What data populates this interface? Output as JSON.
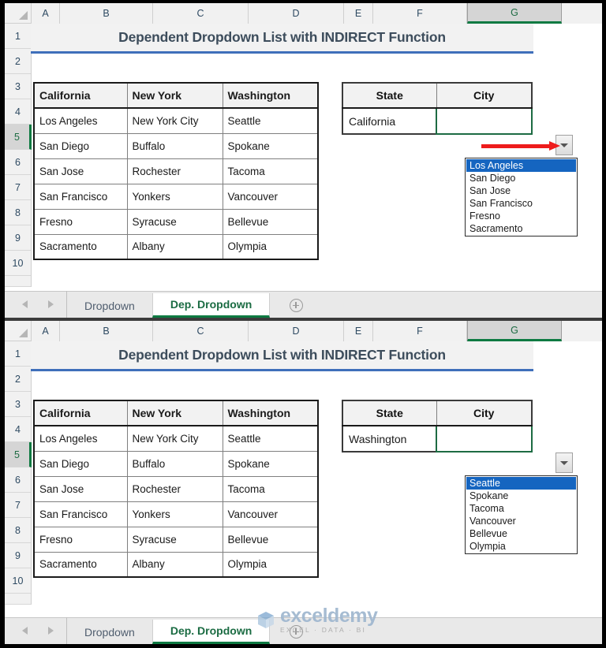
{
  "app": {
    "title": "Dependent Dropdown List with INDIRECT Function"
  },
  "columns": [
    "A",
    "B",
    "C",
    "D",
    "E",
    "F",
    "G"
  ],
  "active_column": "G",
  "rows": [
    "1",
    "2",
    "3",
    "4",
    "5",
    "6",
    "7",
    "8",
    "9",
    "10"
  ],
  "active_row": "5",
  "cities_table": {
    "headers": [
      "California",
      "New York",
      "Washington"
    ],
    "rows": [
      [
        "Los Angeles",
        "New York City",
        "Seattle"
      ],
      [
        "San Diego",
        "Buffalo",
        "Spokane"
      ],
      [
        "San Jose",
        "Rochester",
        "Tacoma"
      ],
      [
        "San Francisco",
        "Yonkers",
        "Vancouver"
      ],
      [
        "Fresno",
        "Syracuse",
        "Bellevue"
      ],
      [
        "Sacramento",
        "Albany",
        "Olympia"
      ]
    ]
  },
  "panel1": {
    "selection_table": {
      "headers": [
        "State",
        "City"
      ],
      "state_value": "California",
      "city_value": ""
    },
    "dropdown": {
      "open": true,
      "selected": "Los Angeles",
      "options": [
        "Los Angeles",
        "San Diego",
        "San Jose",
        "San Francisco",
        "Fresno",
        "Sacramento"
      ]
    },
    "annotation": {
      "type": "red-arrow",
      "points_to": "dropdown-toggle-button"
    }
  },
  "panel2": {
    "selection_table": {
      "headers": [
        "State",
        "City"
      ],
      "state_value": "Washington",
      "city_value": ""
    },
    "dropdown": {
      "open": true,
      "selected": "Seattle",
      "options": [
        "Seattle",
        "Spokane",
        "Tacoma",
        "Vancouver",
        "Bellevue",
        "Olympia"
      ]
    }
  },
  "sheet_tabs": {
    "tabs": [
      "Dropdown",
      "Dep. Dropdown"
    ],
    "active": "Dep. Dropdown",
    "add_label": "+"
  },
  "watermark": {
    "name": "exceldemy",
    "tagline": "EXCEL · DATA · BI"
  },
  "colors": {
    "accent_green": "#0e7a42",
    "title_underline": "#3f6fba",
    "selection_blue": "#1565c0",
    "arrow_red": "#ee1c1c",
    "header_fill": "#f2f2f2"
  }
}
